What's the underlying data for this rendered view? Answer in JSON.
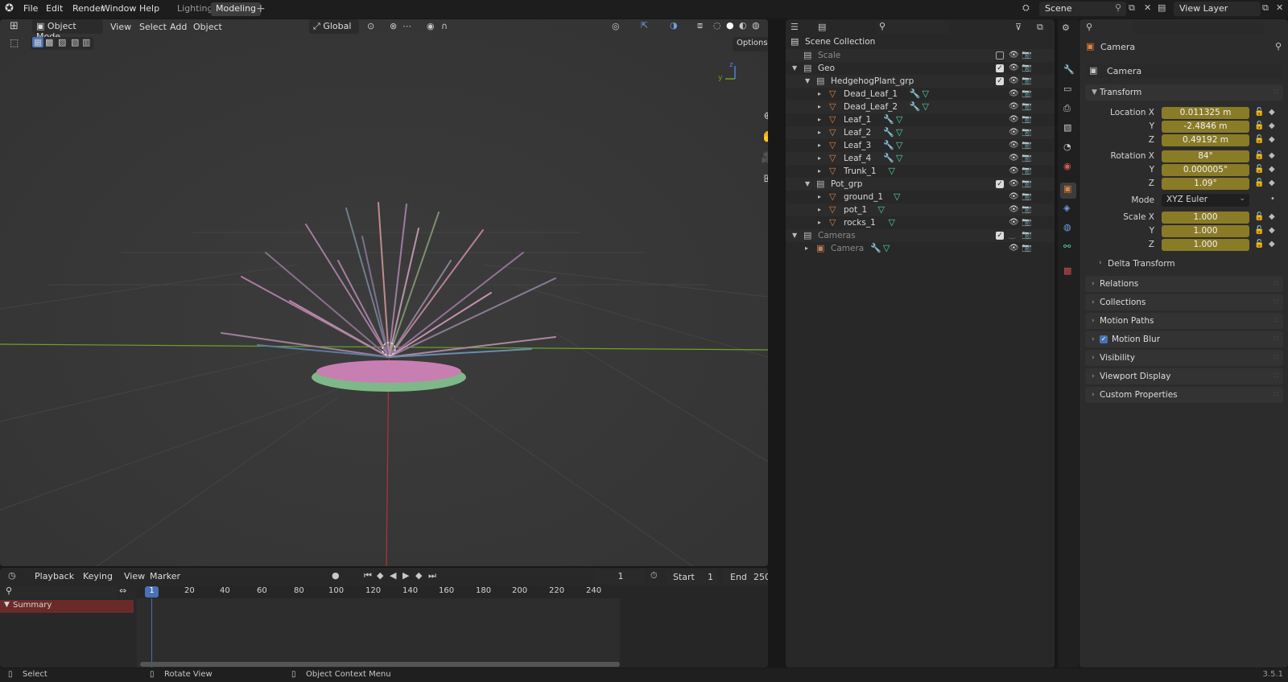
{
  "topbar": {
    "menus": [
      "File",
      "Edit",
      "Render",
      "Window",
      "Help"
    ],
    "workspace_tabs": [
      "Lighting",
      "Modeling"
    ],
    "active_tab": "Modeling",
    "add_tab": "+",
    "scene_name": "Scene",
    "view_layer_name": "View Layer"
  },
  "viewport": {
    "mode": "Object Mode",
    "menus": [
      "View",
      "Select",
      "Add",
      "Object"
    ],
    "transform_orientation": "Global",
    "options_label": "Options",
    "gizmo_y": "y",
    "gizmo_z": "z"
  },
  "timeline": {
    "menus": [
      "Playback",
      "Keying",
      "View",
      "Marker"
    ],
    "current_frame": "1",
    "start_label": "Start",
    "start_value": "1",
    "end_label": "End",
    "end_value": "250",
    "ticks": [
      "1",
      "20",
      "40",
      "60",
      "80",
      "100",
      "120",
      "140",
      "160",
      "180",
      "200",
      "220",
      "240"
    ],
    "summary_label": "Summary"
  },
  "outliner": {
    "scene_collection": "Scene Collection",
    "rows": [
      {
        "label": "Scale"
      },
      {
        "label": "Geo"
      },
      {
        "label": "HedgehogPlant_grp"
      },
      {
        "label": "Dead_Leaf_1"
      },
      {
        "label": "Dead_Leaf_2"
      },
      {
        "label": "Leaf_1"
      },
      {
        "label": "Leaf_2"
      },
      {
        "label": "Leaf_3"
      },
      {
        "label": "Leaf_4"
      },
      {
        "label": "Trunk_1"
      },
      {
        "label": "Pot_grp"
      },
      {
        "label": "ground_1"
      },
      {
        "label": "pot_1"
      },
      {
        "label": "rocks_1"
      },
      {
        "label": "Cameras"
      },
      {
        "label": "Camera"
      }
    ]
  },
  "properties": {
    "header_object": "Camera",
    "object_name": "Camera",
    "transform_title": "Transform",
    "location_label": "Location X",
    "location": [
      "0.011325 m",
      "-2.4846 m",
      "0.49192 m"
    ],
    "rotation_label": "Rotation X",
    "rotation": [
      "84°",
      "0.000005°",
      "1.09°"
    ],
    "mode_label": "Mode",
    "mode_value": "XYZ Euler",
    "scale_label": "Scale X",
    "scale": [
      "1.000",
      "1.000",
      "1.000"
    ],
    "axis_y": "Y",
    "axis_z": "Z",
    "delta_transform": "Delta Transform",
    "panels": [
      "Relations",
      "Collections",
      "Motion Paths",
      "Motion Blur",
      "Visibility",
      "Viewport Display",
      "Custom Properties"
    ]
  },
  "statusbar": {
    "select": "Select",
    "rotate_view": "Rotate View",
    "context_menu": "Object Context Menu",
    "version": "3.5.1"
  },
  "colors": {
    "value_field": "#8a7b27",
    "mesh_icon": "#e0813a",
    "modifier_icon": "#6f9fe0",
    "data_icon": "#4fd8a4",
    "x_axis": "#b5323a",
    "y_axis": "#6aa32a"
  }
}
